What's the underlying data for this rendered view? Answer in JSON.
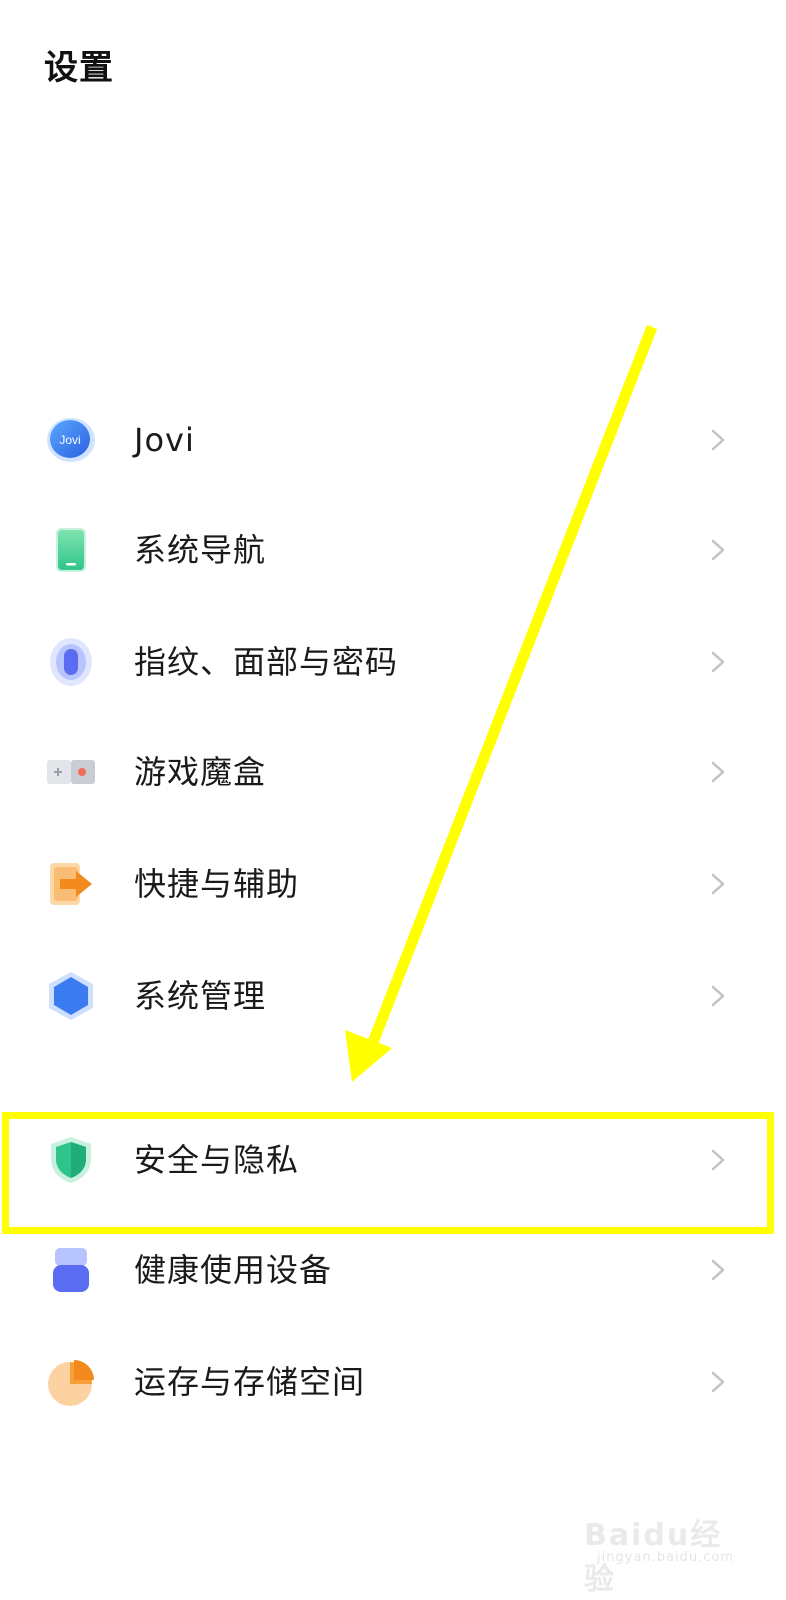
{
  "header": {
    "title": "设置"
  },
  "settings_items": [
    {
      "label": "Jovi",
      "icon": "jovi-icon",
      "icon_text": "Jovi"
    },
    {
      "label": "系统导航",
      "icon": "phone-navigation-icon"
    },
    {
      "label": "指纹、面部与密码",
      "icon": "fingerprint-icon"
    },
    {
      "label": "游戏魔盒",
      "icon": "game-box-icon"
    },
    {
      "label": "快捷与辅助",
      "icon": "shortcut-arrow-icon"
    },
    {
      "label": "系统管理",
      "icon": "system-hexagon-icon"
    },
    {
      "label": "安全与隐私",
      "icon": "shield-icon"
    },
    {
      "label": "健康使用设备",
      "icon": "health-hourglass-icon"
    },
    {
      "label": "运存与存储空间",
      "icon": "storage-pie-icon"
    }
  ],
  "annotation": {
    "highlight_color": "#ffff00",
    "highlighted_item": "安全与隐私"
  },
  "watermark": {
    "brand": "Baidu经验",
    "url": "jingyan.baidu.com"
  },
  "colors": {
    "background": "#ffffff",
    "text": "#1a1a1a",
    "chevron": "#c2c2c2",
    "accent_blue": "#3b7bf0",
    "accent_green": "#2fc58a",
    "accent_orange": "#f7a03a"
  }
}
